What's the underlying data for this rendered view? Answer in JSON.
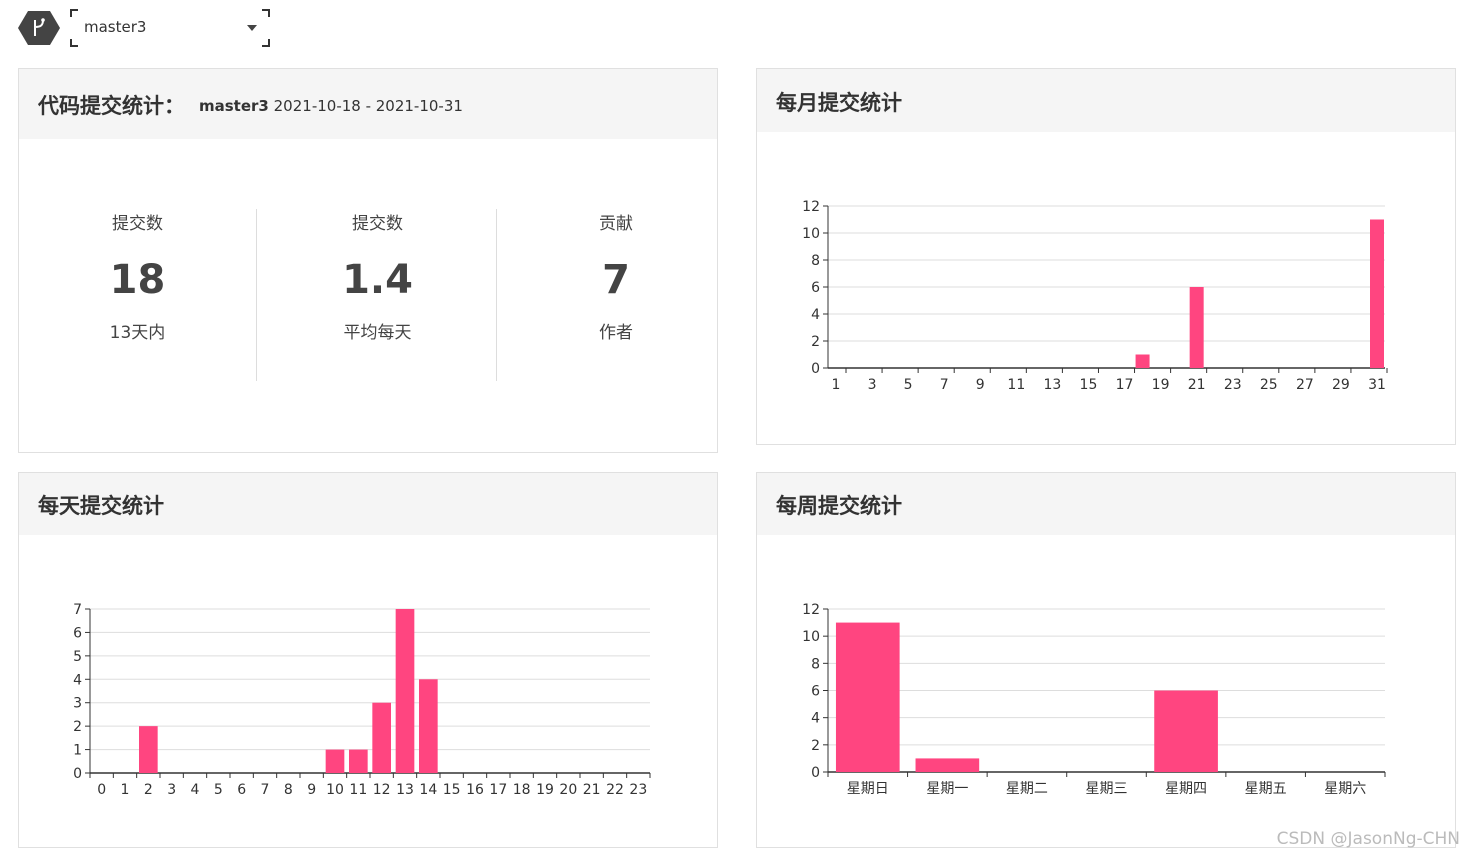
{
  "branch": {
    "selected": "master3"
  },
  "stats_panel": {
    "title": "代码提交统计：",
    "branch": "master3",
    "range": "2021-10-18 - 2021-10-31",
    "items": [
      {
        "label": "提交数",
        "value": "18",
        "sub": "13天内"
      },
      {
        "label": "提交数",
        "value": "1.4",
        "sub": "平均每天"
      },
      {
        "label": "贡献",
        "value": "7",
        "sub": "作者"
      }
    ]
  },
  "monthly_panel": {
    "title": "每月提交统计"
  },
  "daily_panel": {
    "title": "每天提交统计"
  },
  "weekly_panel": {
    "title": "每周提交统计"
  },
  "watermark": "CSDN @JasonNg-CHN",
  "colors": {
    "bar": "#ff4580",
    "grid": "#dddddd",
    "axis": "#333333",
    "panel_header": "#f5f5f5"
  },
  "chart_data": [
    {
      "id": "monthly",
      "type": "bar",
      "categories": [
        "1",
        "2",
        "3",
        "4",
        "5",
        "6",
        "7",
        "8",
        "9",
        "10",
        "11",
        "12",
        "13",
        "14",
        "15",
        "16",
        "17",
        "18",
        "19",
        "20",
        "21",
        "22",
        "23",
        "24",
        "25",
        "26",
        "27",
        "28",
        "29",
        "30",
        "31"
      ],
      "tick_labels": [
        "1",
        "3",
        "5",
        "7",
        "9",
        "11",
        "13",
        "15",
        "17",
        "19",
        "21",
        "23",
        "25",
        "27",
        "29",
        "31"
      ],
      "values": [
        0,
        0,
        0,
        0,
        0,
        0,
        0,
        0,
        0,
        0,
        0,
        0,
        0,
        0,
        0,
        0,
        0,
        1,
        0,
        0,
        6,
        0,
        0,
        0,
        0,
        0,
        0,
        0,
        0,
        0,
        11
      ],
      "ylim": [
        0,
        12
      ],
      "yticks": [
        0,
        2,
        4,
        6,
        8,
        10,
        12
      ],
      "grid": true
    },
    {
      "id": "daily",
      "type": "bar",
      "categories": [
        "0",
        "1",
        "2",
        "3",
        "4",
        "5",
        "6",
        "7",
        "8",
        "9",
        "10",
        "11",
        "12",
        "13",
        "14",
        "15",
        "16",
        "17",
        "18",
        "19",
        "20",
        "21",
        "22",
        "23"
      ],
      "values": [
        0,
        0,
        2,
        0,
        0,
        0,
        0,
        0,
        0,
        0,
        1,
        1,
        3,
        7,
        4,
        0,
        0,
        0,
        0,
        0,
        0,
        0,
        0,
        0
      ],
      "ylim": [
        0,
        7
      ],
      "yticks": [
        0,
        1,
        2,
        3,
        4,
        5,
        6,
        7
      ],
      "grid": true
    },
    {
      "id": "weekly",
      "type": "bar",
      "categories": [
        "星期日",
        "星期一",
        "星期二",
        "星期三",
        "星期四",
        "星期五",
        "星期六"
      ],
      "values": [
        11,
        1,
        0,
        0,
        6,
        0,
        0
      ],
      "ylim": [
        0,
        12
      ],
      "yticks": [
        0,
        2,
        4,
        6,
        8,
        10,
        12
      ],
      "grid": true
    }
  ]
}
